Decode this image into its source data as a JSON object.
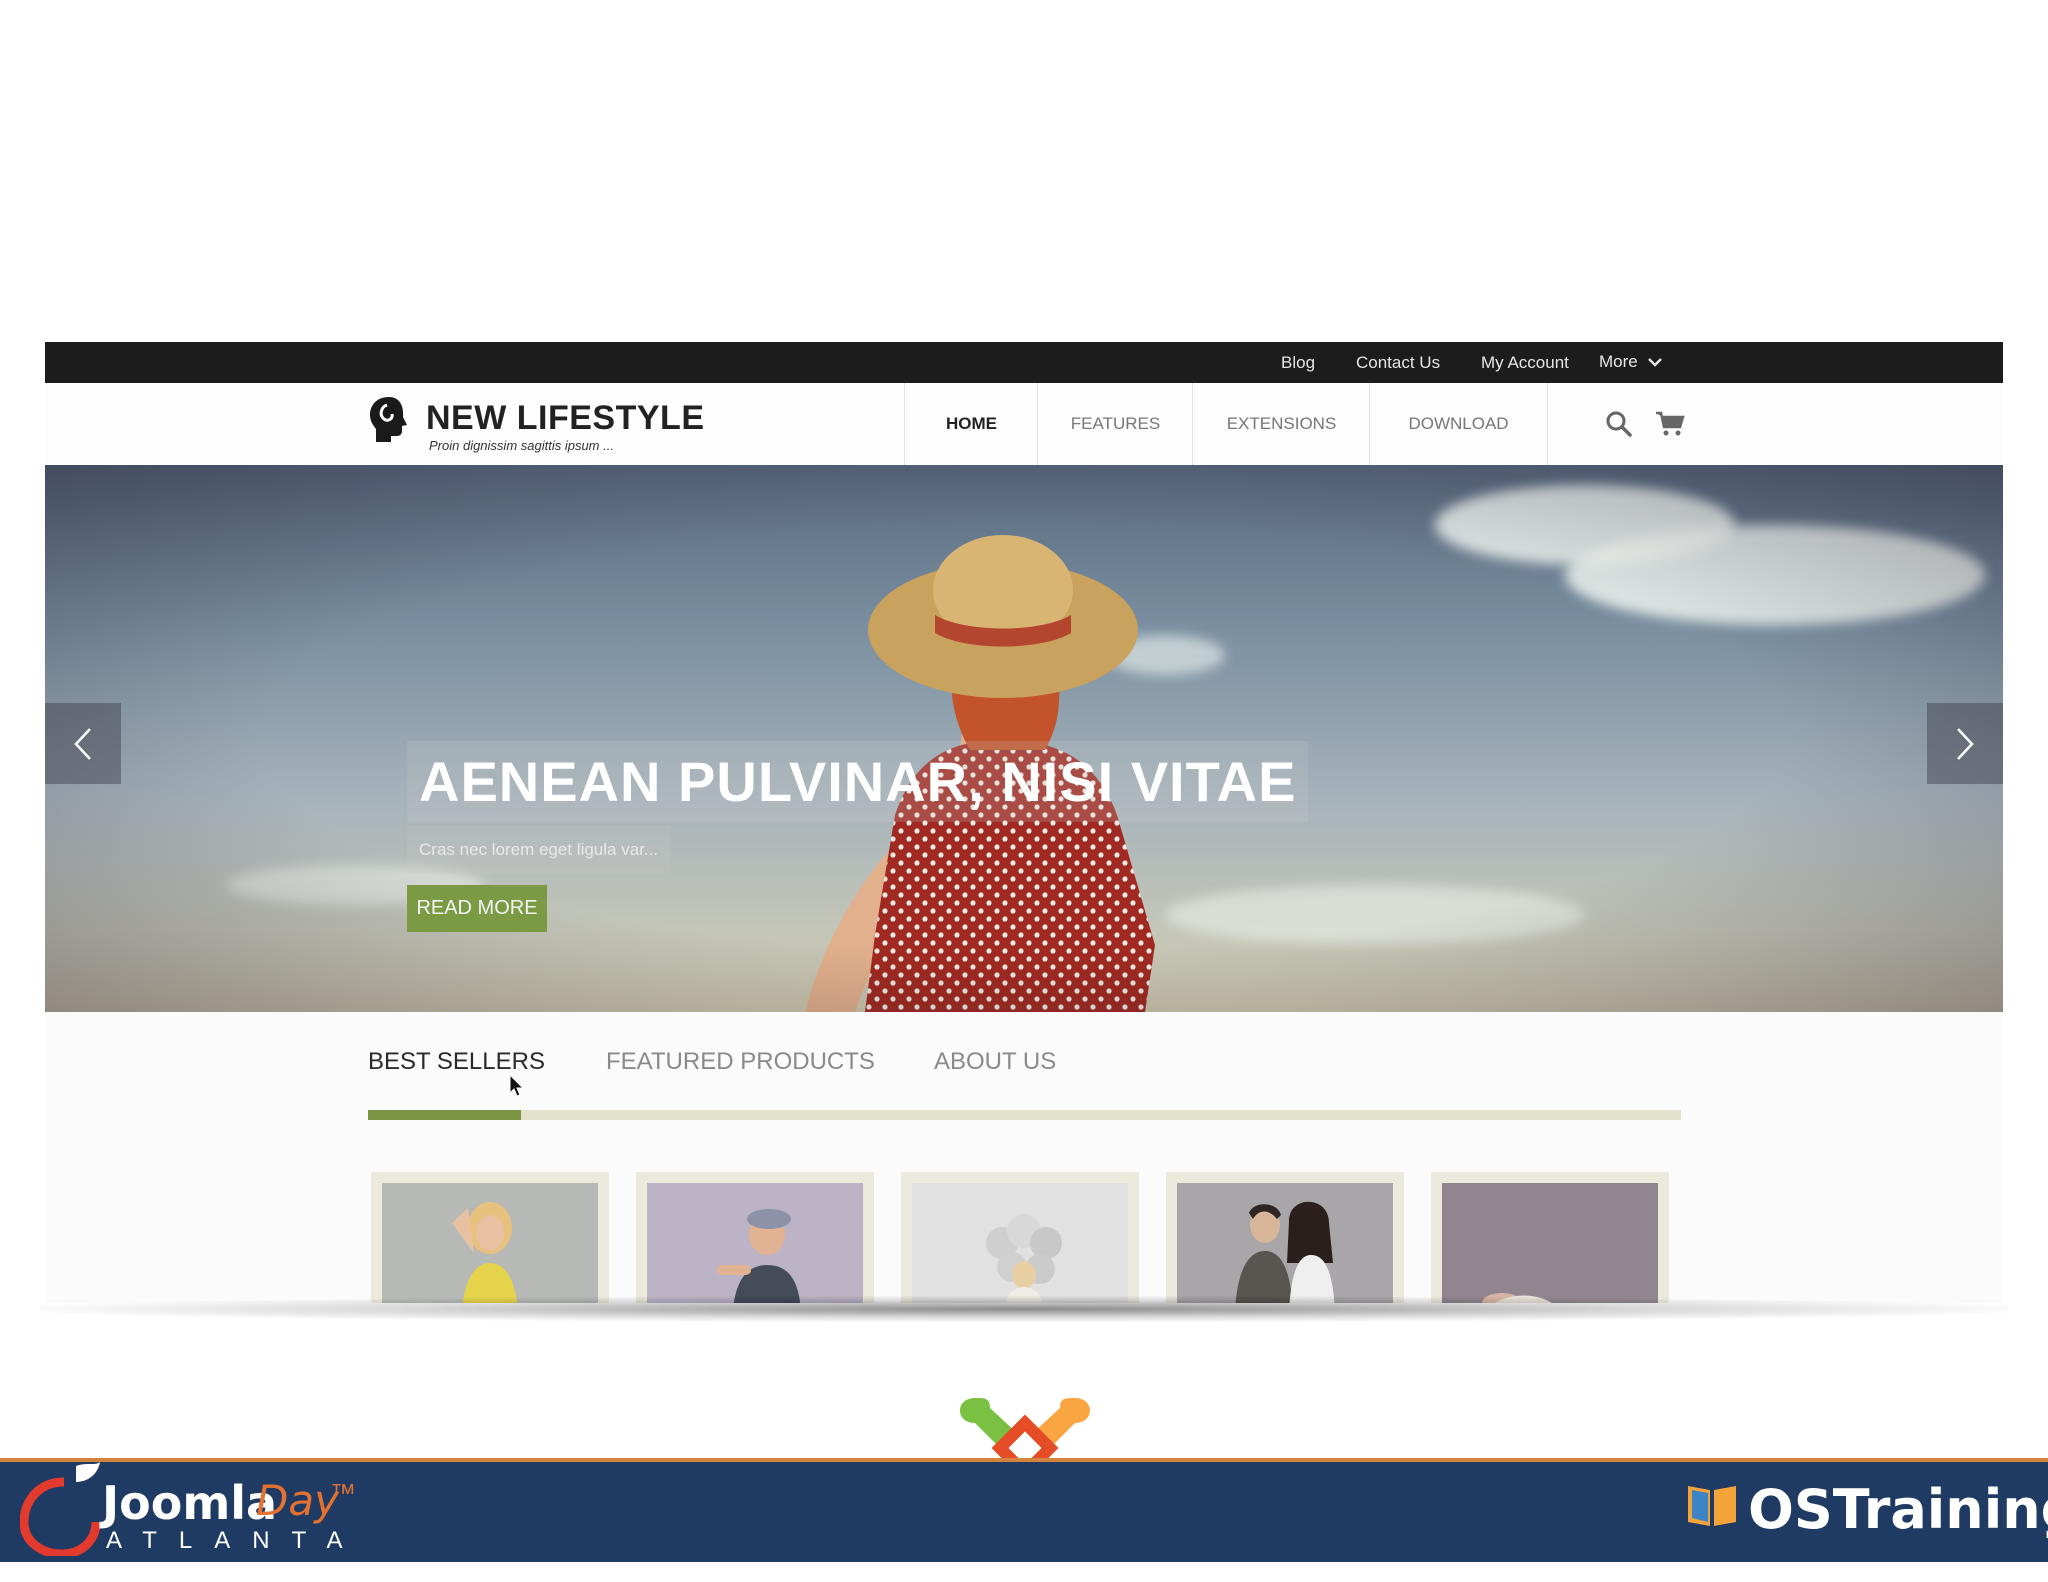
{
  "topbar": {
    "links": [
      "Blog",
      "Contact Us",
      "My Account"
    ],
    "more_label": "More"
  },
  "header": {
    "site_title": "NEW LIFESTYLE",
    "tagline": "Proin dignissim sagittis ipsum ...",
    "nav": [
      "HOME",
      "FEATURES",
      "EXTENSIONS",
      "DOWNLOAD"
    ],
    "active_nav": "HOME"
  },
  "hero": {
    "title": "AENEAN PULVINAR, NISI VITAE",
    "subtitle": "Cras nec lorem eget ligula var...",
    "button": "READ MORE",
    "accent": "#7a9a44"
  },
  "tabs": {
    "items": [
      "BEST SELLERS",
      "FEATURED PRODUCTS",
      "ABOUT US"
    ],
    "active": "BEST SELLERS",
    "accent": "#7b9444"
  },
  "products": [
    {
      "icon": "woman-yellow-top-photo"
    },
    {
      "icon": "boy-with-cap-photo"
    },
    {
      "icon": "woman-with-balloons-photo"
    },
    {
      "icon": "couple-photo"
    },
    {
      "icon": "reclining-figure-photo"
    }
  ],
  "footer": {
    "left_brand_main": "Joomla",
    "left_brand_accent": "Day",
    "left_brand_tm": "™",
    "left_brand_city": "ATLANTA",
    "right_brand": "OSTraining",
    "bar_color": "#1f3a63"
  }
}
